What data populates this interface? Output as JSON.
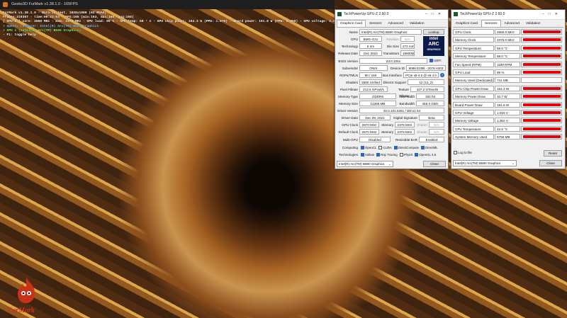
{
  "furmark": {
    "window_title": "Geeks3D FurMark v1.38.1.0 - 165FPS",
    "osd": [
      {
        "text": "FurMark v1.38.1.0 - Burn-in test, 1920x1080 (0X MSAA)",
        "color": "#ffffff"
      },
      {
        "text": "Frames:219367 - time:00:23:03 - FPS:165 (min:163, max:168, avg:168)",
        "color": "#ffffff"
      },
      {
        "text": "[ GPU-Z ] core: 2650 MHz - mem: 2375 MHz - GPU load: 99 % - GPU temp: 58 ° C - GPU chip power: 154.3 W (PPW: 1.070) - Board power: 191.8 W (PPW: 0.860) - GPU voltage: 1.015 V",
        "color": "#ffffff"
      },
      {
        "text": "> OpenGL renderer: Intel(R) Arc(TM) B580 Graphics",
        "color": "#7fc8ff"
      },
      {
        "text": "> GPU 1 (Intel(R) Arc(TM) B580 Graphics)",
        "color": "#7dff6a"
      },
      {
        "text": "- F1: toggle help",
        "color": "#ffffff"
      }
    ],
    "logo_text": "FurMark"
  },
  "gpuz_card": {
    "title": "TechPowerUp GPU-Z 2.60.0",
    "tabs": [
      "Graphics Card",
      "Sensors",
      "Advanced",
      "Validation"
    ],
    "name": {
      "label": "Name",
      "value": "Intel(R) Arc(TM) B580 Graphics",
      "button": "Lookup"
    },
    "gpu": {
      "label": "GPU",
      "value": "BMG-G21",
      "rev_label": "Revision",
      "rev_value": "N/A"
    },
    "tech": {
      "label": "Technology",
      "value": "5 nm",
      "die_label": "Die Size",
      "die_value": "272 mm²"
    },
    "release": {
      "label": "Release Date",
      "value": "Dec 2024",
      "tr_label": "Transistors",
      "tr_value": "19600M"
    },
    "bios": {
      "label": "BIOS Version",
      "value": "23.0.1051",
      "uefi": "UEFI"
    },
    "subvendor": {
      "label": "Subvendor",
      "value": "ONIX",
      "dev_label": "Device ID",
      "dev_value": "8086 E20B - 2076 A003"
    },
    "rops": {
      "label": "ROPs/TMUs",
      "value": "80 / 160",
      "bus_label": "Bus Interface",
      "bus_value": "PCIe x8 4.0 @ x8 4.0"
    },
    "shaders": {
      "label": "Shaders",
      "value": "2560 Unified",
      "dx_label": "DirectX Support",
      "dx_value": "12 (12_2)"
    },
    "pixel": {
      "label": "Pixel Fillrate",
      "value": "213.6 GPixel/s",
      "tex_label": "Texture Fillrate",
      "tex_value": "427.2 GTexel/s"
    },
    "memtype": {
      "label": "Memory Type",
      "value": "GDDR6",
      "bw_label": "Bus Width",
      "bw_value": "192 bit"
    },
    "memsize": {
      "label": "Memory Size",
      "value": "12288 MB",
      "band_label": "Bandwidth",
      "band_value": "456.0 GB/s"
    },
    "driver": {
      "label": "Driver Version",
      "value": "32.0.101.6251 / Win11 64"
    },
    "driverdate": {
      "label": "Driver Date",
      "value": "Dec 09, 2024",
      "sig_label": "Digital Signature",
      "sig_value": "Beta"
    },
    "gpuclock": {
      "label": "GPU Clock",
      "value": "2670 MHz",
      "mem_label": "Memory",
      "mem_value": "2375 MHz",
      "shader_label": "Shader",
      "shader_value": "N/A"
    },
    "defclock": {
      "label": "Default Clock",
      "value": "2670 MHz",
      "mem_label": "Memory",
      "mem_value": "2375 MHz",
      "shader_label": "Shader",
      "shader_value": "N/A"
    },
    "multigpu": {
      "label": "Multi-GPU",
      "value": "Disabled",
      "rbar_label": "Resizable BAR",
      "rbar_value": "Enabled"
    },
    "computing": {
      "label": "Computing",
      "items": [
        "OpenCL",
        "CUDA",
        "DirectCompute",
        "DirectML"
      ],
      "checked": [
        true,
        false,
        true,
        true
      ]
    },
    "technologies": {
      "label": "Technologies",
      "items": [
        "Vulkan",
        "Ray Tracing",
        "PhysX",
        "OpenGL 4.6"
      ],
      "checked": [
        true,
        true,
        false,
        true
      ]
    },
    "select_value": "Intel(R) Arc(TM) B580 Graphics",
    "close": "Close",
    "vendor_logo": {
      "line1": "intel",
      "line2": "ARC",
      "line3": "GRAPHICS"
    }
  },
  "gpuz_sensors": {
    "title": "TechPowerUp GPU-Z 2.60.0",
    "tabs": [
      "Graphics Card",
      "Sensors",
      "Advanced",
      "Validation"
    ],
    "rows": [
      {
        "label": "GPU Clock",
        "value": "2650.0 MHz",
        "level": 0.95
      },
      {
        "label": "Memory Clock",
        "value": "2375.0 MHz",
        "level": 0.95
      },
      {
        "label": "GPU Temperature",
        "value": "59.0 °C",
        "level": 0.95
      },
      {
        "label": "Memory Temperature",
        "value": "58.0 °C",
        "level": 0.95
      },
      {
        "label": "Fan Speed (RPM)",
        "value": "1199 RPM",
        "level": 0.95
      },
      {
        "label": "GPU Load",
        "value": "99 %",
        "level": 0.95
      },
      {
        "label": "Memory Used (Dedicated)",
        "value": "741 MB",
        "level": 0.0
      },
      {
        "label": "GPU Chip Power Draw",
        "value": "154.3 W",
        "level": 0.95
      },
      {
        "label": "Memory Power Draw",
        "value": "10.7 W",
        "level": 0.95
      },
      {
        "label": "Board Power Draw",
        "value": "191.8 W",
        "level": 0.95
      },
      {
        "label": "GPU Voltage",
        "value": "1.015 V",
        "level": 0.95
      },
      {
        "label": "Memory Voltage",
        "value": "1.352 V",
        "level": 0.95
      },
      {
        "label": "CPU Temperature",
        "value": "42.6 °C",
        "level": 0.95
      },
      {
        "label": "System Memory Used",
        "value": "6758 MB",
        "level": 0.95
      }
    ],
    "log_to_file": "Log to file",
    "reset": "Reset",
    "select_value": "Intel(R) Arc(TM) B580 Graphics",
    "close": "Close"
  },
  "colors": {
    "graph": "#e8000b",
    "accent": "#2b65c8",
    "logo": "#c8311a"
  }
}
